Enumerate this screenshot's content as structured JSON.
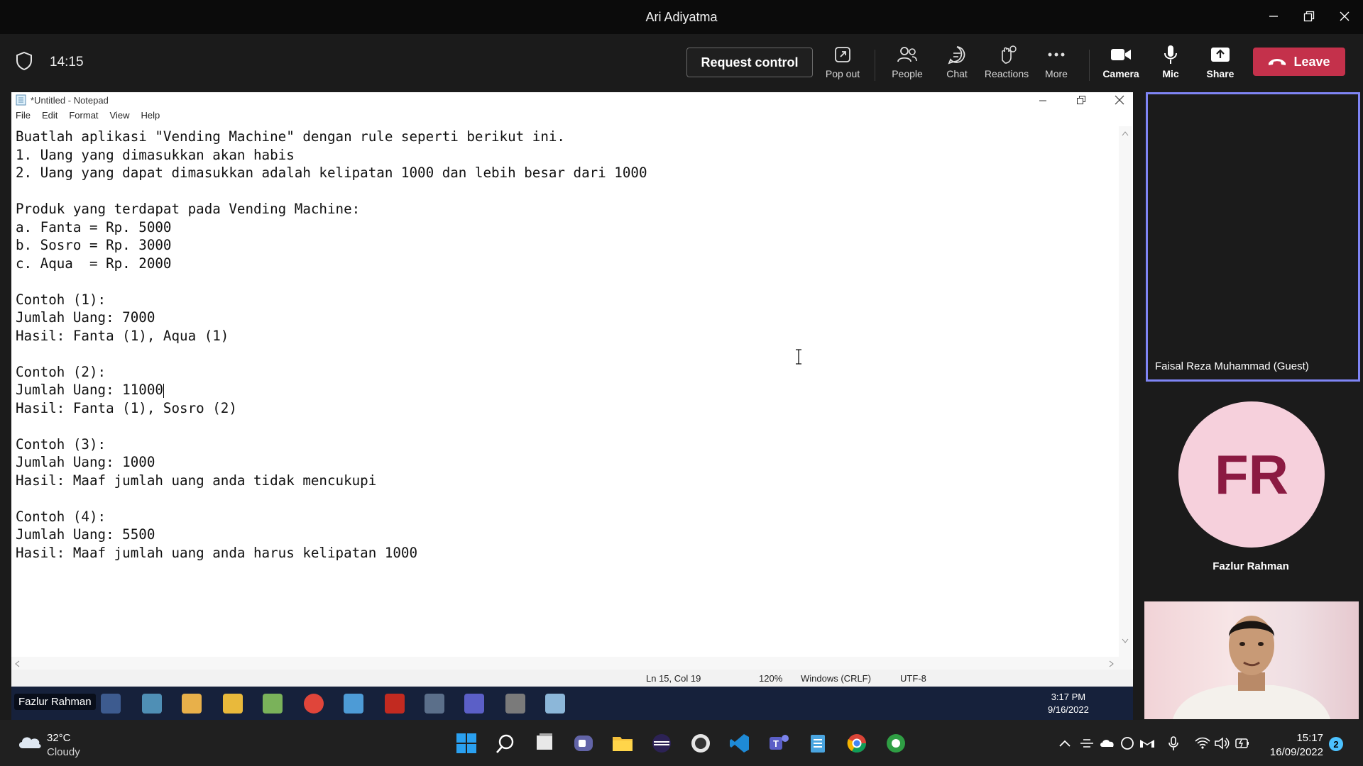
{
  "window": {
    "title": "Ari Adiyatma"
  },
  "toolbar": {
    "timer": "14:15",
    "request_control": "Request control",
    "buttons": {
      "popout": "Pop out",
      "people": "People",
      "chat": "Chat",
      "reactions": "Reactions",
      "more": "More",
      "camera": "Camera",
      "mic": "Mic",
      "share": "Share"
    },
    "leave": "Leave",
    "leave_color": "#c4314b"
  },
  "notepad": {
    "title": "*Untitled - Notepad",
    "menu": [
      "File",
      "Edit",
      "Format",
      "View",
      "Help"
    ],
    "lines": [
      "Buatlah aplikasi \"Vending Machine\" dengan rule seperti berikut ini.",
      "1. Uang yang dimasukkan akan habis",
      "2. Uang yang dapat dimasukkan adalah kelipatan 1000 dan lebih besar dari 1000",
      "",
      "Produk yang terdapat pada Vending Machine:",
      "a. Fanta = Rp. 5000",
      "b. Sosro = Rp. 3000",
      "c. Aqua  = Rp. 2000",
      "",
      "Contoh (1):",
      "Jumlah Uang: 7000",
      "Hasil: Fanta (1), Aqua (1)",
      "",
      "Contoh (2):",
      "Jumlah Uang: 11000",
      "Hasil: Fanta (1), Sosro (2)",
      "",
      "Contoh (3):",
      "Jumlah Uang: 1000",
      "Hasil: Maaf jumlah uang anda tidak mencukupi",
      "",
      "Contoh (4):",
      "Jumlah Uang: 5500",
      "Hasil: Maaf jumlah uang anda harus kelipatan 1000"
    ],
    "status": {
      "position": "Ln 15, Col 19",
      "zoom": "120%",
      "line_ending": "Windows (CRLF)",
      "encoding": "UTF-8"
    }
  },
  "shared_taskbar": {
    "presenter_name": "Fazlur Rahman",
    "time": "3:17 PM",
    "date": "9/16/2022"
  },
  "participants": {
    "tile1_name": "Faisal Reza Muhammad (Guest)",
    "tile1_border": "#7f85f5",
    "avatar_initials": "FR",
    "avatar_name": "Fazlur Rahman",
    "avatar_bg": "#f6d0dc",
    "avatar_fg": "#8b1a42"
  },
  "system_taskbar": {
    "weather_temp": "32°C",
    "weather_desc": "Cloudy",
    "time": "15:17",
    "date": "16/09/2022",
    "notifications": "2"
  }
}
